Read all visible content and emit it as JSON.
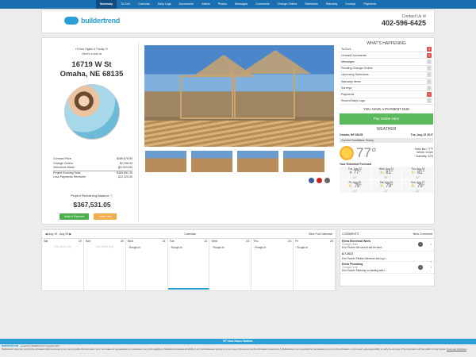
{
  "nav": [
    "Summary",
    "To-Do's",
    "Calendar",
    "Daily Logs",
    "Documents",
    "Videos",
    "Photos",
    "Messages",
    "Comments",
    "Change Orders",
    "Selections",
    "Warranty",
    "Surveys",
    "Payments"
  ],
  "header": {
    "logo": "buildertrend",
    "contact_label": "Contact Us",
    "phone": "402-596-6425"
  },
  "profile": {
    "greeting": "Hi Dan Digilio & Family !!!",
    "subgreeting": "Here's a look at",
    "address1": "16719 W St",
    "address2": "Omaha, NE 68135",
    "costs": [
      {
        "label": "Contract Price:",
        "value": "$389,678.95"
      },
      {
        "label": "Change Orders:",
        "value": "$2,296.00"
      },
      {
        "label": "Selections Made:",
        "value": "($2,023.50)"
      },
      {
        "label": "Project Running Total:",
        "value": "$389,851.35"
      },
      {
        "label": "Less Payments Received:",
        "value": "$22,320.00"
      }
    ],
    "balance_label": "Project Remaining Balance",
    "balance": "$367,531.05",
    "make_payment": "Make A Payment",
    "learn_how": "Learn How"
  },
  "happening": {
    "title": "WHAT'S HAPPENING",
    "items": [
      {
        "label": "To-Do's",
        "count": "3",
        "alert": true
      },
      {
        "label": "Unread Documents",
        "count": "3",
        "alert": true
      },
      {
        "label": "Messages",
        "count": "0",
        "alert": false
      },
      {
        "label": "Pending Change Orders",
        "count": "0",
        "alert": false
      },
      {
        "label": "Upcoming Selections",
        "count": "0",
        "alert": false
      },
      {
        "label": "Warranty Items",
        "count": "0",
        "alert": false
      },
      {
        "label": "Surveys",
        "count": "0",
        "alert": false
      },
      {
        "label": "Payments",
        "count": "1",
        "alert": true
      },
      {
        "label": "Recent Daily Logs",
        "count": "0",
        "alert": false
      }
    ],
    "payment_due": "YOU HAVE A PAYMENT DUE",
    "pay_button": "Pay Online Here"
  },
  "weather": {
    "title": "WEATHER",
    "location": "Omaha, NE 68135",
    "date": "Tue, Aug 22 2017",
    "conditions": "Current Conditions: Sunny",
    "temp": "77°",
    "feels": "Feels like: 77°F",
    "wind": "Winds: 6 mph",
    "humidity": "Humidity: 42%",
    "extended": "Your Extended Forecast",
    "forecast": [
      {
        "day": "Tue, Aug 22",
        "hi": "77°",
        "lo": "56°"
      },
      {
        "day": "Wed, Aug 23",
        "hi": "81°",
        "lo": "58°"
      },
      {
        "day": "Thu, Aug 24",
        "hi": "81°",
        "lo": "62°"
      },
      {
        "day": "Fri, Aug 25",
        "hi": "79°",
        "lo": "63°"
      },
      {
        "day": "Sat, Aug 26",
        "hi": "79°",
        "lo": "63°"
      },
      {
        "day": "Sun, Aug 27",
        "hi": "79°",
        "lo": "63°"
      }
    ]
  },
  "calendar": {
    "range": "Aug 19 - Aug 25",
    "title": "Calendar",
    "view_full": "View Full Calendar",
    "days": [
      {
        "name": "Sat",
        "num": "19",
        "event": "",
        "nonwork": "Non-Work Day"
      },
      {
        "name": "Sun",
        "num": "20",
        "event": "",
        "nonwork": "Non-Work Day"
      },
      {
        "name": "Mon",
        "num": "21",
        "event": "Rough-In",
        "nonwork": ""
      },
      {
        "name": "Tue",
        "num": "22",
        "event": "Rough-In",
        "nonwork": ""
      },
      {
        "name": "Wed",
        "num": "23",
        "event": "Rough-In",
        "nonwork": ""
      },
      {
        "name": "Thu",
        "num": "24",
        "event": "Rough-In",
        "nonwork": ""
      },
      {
        "name": "Fri",
        "num": "25",
        "event": "Rough-In",
        "nonwork": ""
      }
    ]
  },
  "comments": {
    "title": "COMMENTS",
    "new": "New Comment",
    "items": [
      {
        "title": "Extra Electrical Work",
        "type": "Change Order",
        "text": "Eric Fischer We should still be start...",
        "count": "4"
      },
      {
        "date": "8-7-2017",
        "title": "",
        "type": "",
        "text": "Eric Fischer Please reference this log f...",
        "count": ""
      },
      {
        "title": "Extra Plumbing",
        "type": "Change Order",
        "text": "Eric Fischer Planning on starting with t...",
        "count": "2"
      }
    ]
  },
  "footer": {
    "bar": "BT New Home Builder",
    "line1": "powered by Buildertrend © Copyright 2017",
    "line2": "Buildertrend hopes that you find the information helpful and easy to use, but it provides the information \"as is\" and makes no representations or warranties of any kind regarding it. Buildertrend disclaims all liability of any kind whatsoever arising out of your use of the service and the information contained on it. Buildertrend is not responsible for inaccuracies or errors in the information. It is the user's sole responsibility to verify the accuracy of the information with the builder or other parties.",
    "links": "Terms and Conditions"
  }
}
